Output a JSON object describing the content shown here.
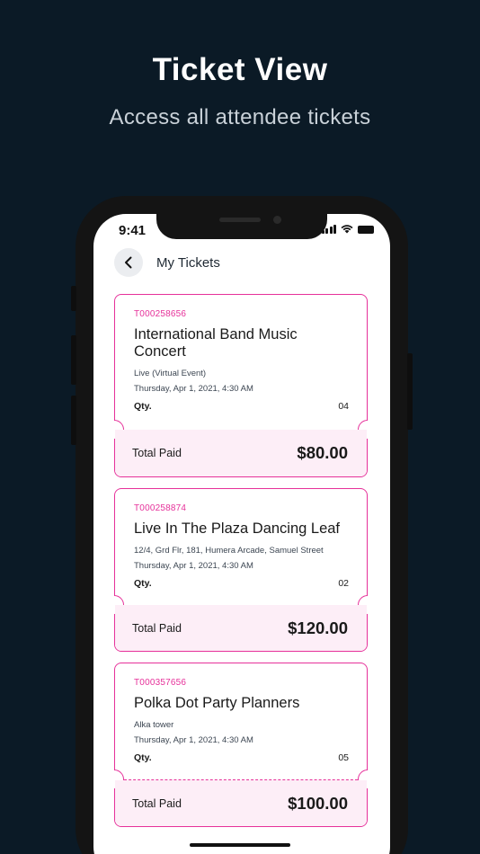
{
  "headline": "Ticket View",
  "subheadline": "Access all attendee tickets",
  "status_bar": {
    "time": "9:41"
  },
  "header": {
    "title": "My Tickets"
  },
  "tickets": [
    {
      "id": "T000258656",
      "name": "International Band Music Concert",
      "venue": "Live (Virtual Event)",
      "date": "Thursday, Apr 1, 2021, 4:30 AM",
      "qty_label": "Qty.",
      "qty": "04",
      "total_label": "Total Paid",
      "total": "$80.00"
    },
    {
      "id": "T000258874",
      "name": "Live In The Plaza Dancing Leaf",
      "venue": "12/4, Grd Flr, 181, Humera Arcade, Samuel Street",
      "date": "Thursday, Apr 1, 2021, 4:30 AM",
      "qty_label": "Qty.",
      "qty": "02",
      "total_label": "Total Paid",
      "total": "$120.00"
    },
    {
      "id": "T000357656",
      "name": "Polka Dot Party Planners",
      "venue": "Alka tower",
      "date": "Thursday, Apr 1, 2021, 4:30 AM",
      "qty_label": "Qty.",
      "qty": "05",
      "total_label": "Total Paid",
      "total": "$100.00"
    }
  ],
  "colors": {
    "background": "#0b1a26",
    "accent": "#e6319a",
    "ticket_footer": "#fdeef7"
  },
  "icons": {
    "back": "chevron-left-icon",
    "signal": "cellular-signal-icon",
    "wifi": "wifi-icon",
    "battery": "battery-icon"
  }
}
